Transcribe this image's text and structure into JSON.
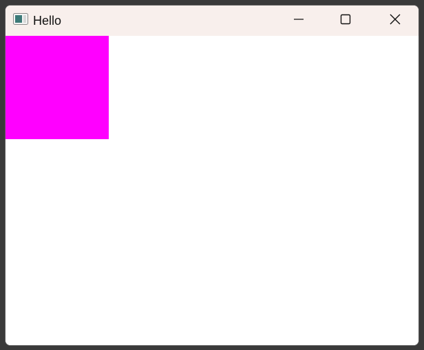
{
  "window": {
    "title": "Hello",
    "titlebar_color": "#f8efec"
  },
  "icons": {
    "app": "app-window-icon",
    "minimize": "minimize-icon",
    "maximize": "maximize-icon",
    "close": "close-icon"
  },
  "canvas": {
    "background": "#ffffff",
    "square_color": "#ff00ff"
  }
}
